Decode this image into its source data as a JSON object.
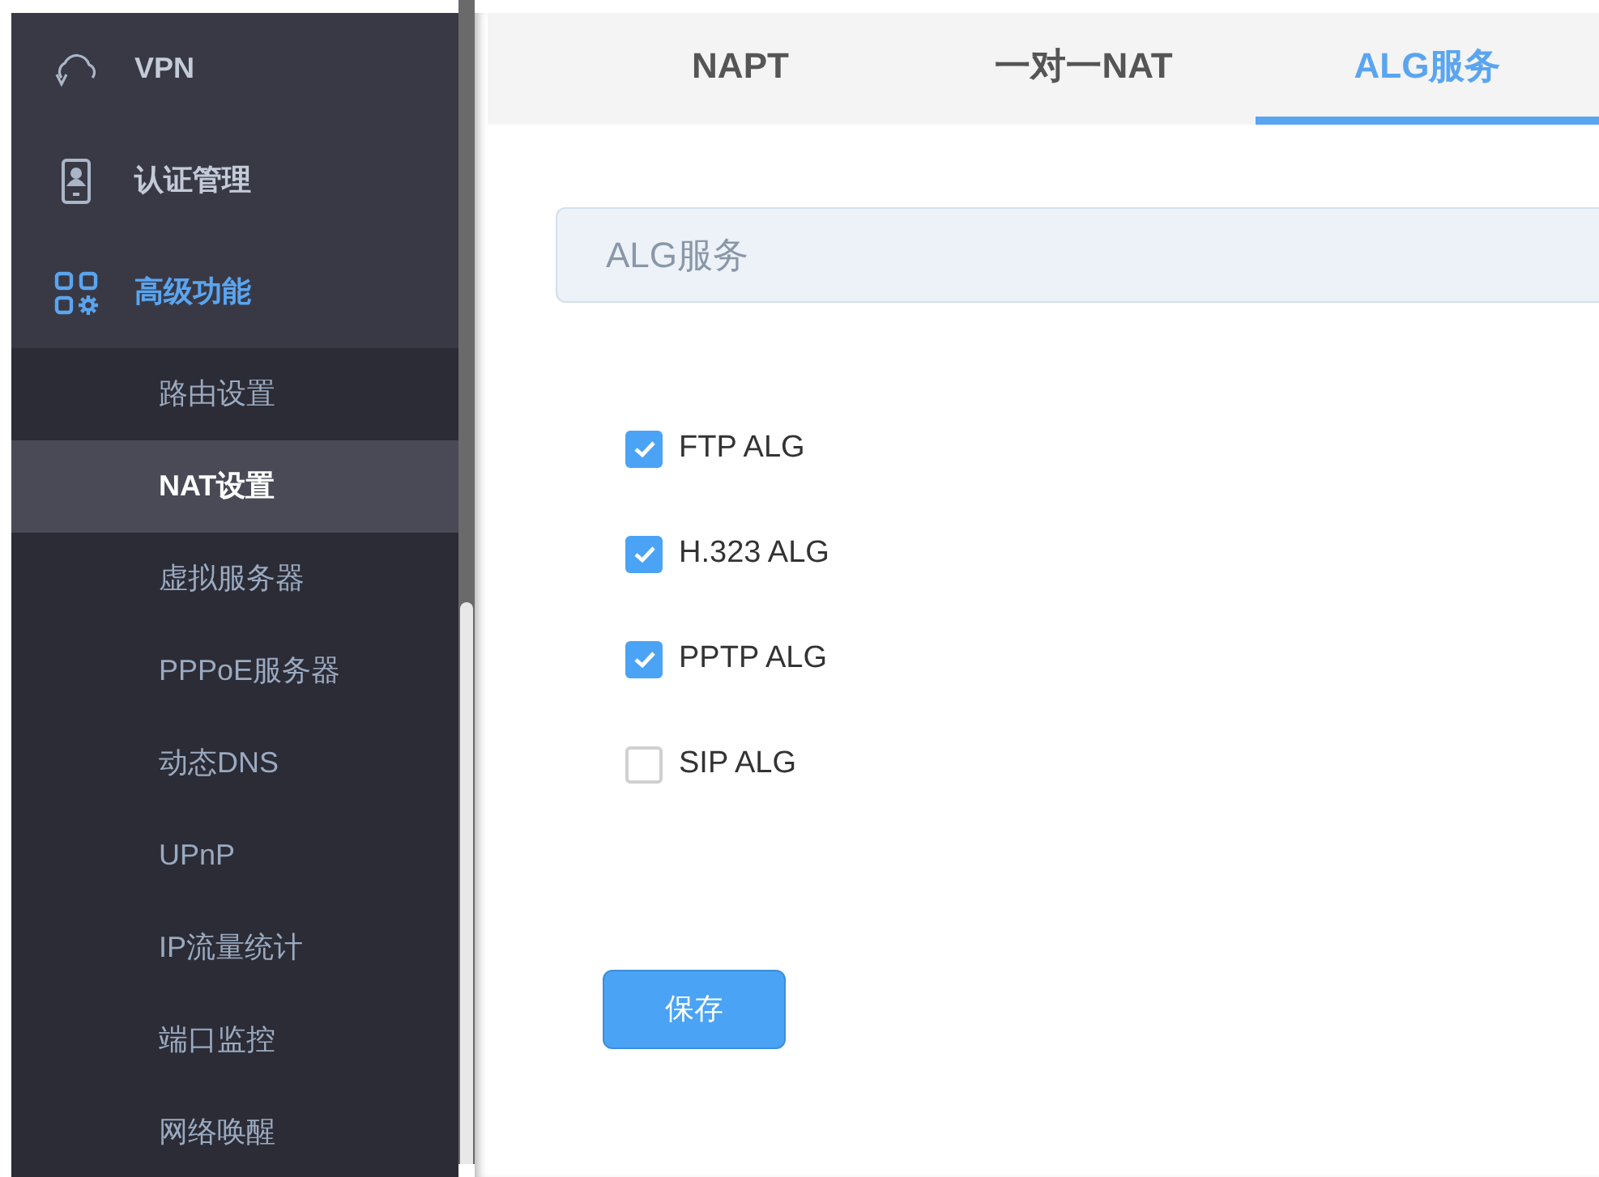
{
  "sidebar": {
    "items": [
      {
        "label": "VPN",
        "kind": "vpn",
        "selected": false
      },
      {
        "label": "认证管理",
        "kind": "auth",
        "selected": false
      },
      {
        "label": "高级功能",
        "kind": "advanced",
        "selected": true,
        "expanded": true,
        "children": [
          {
            "label": "路由设置",
            "selected": false
          },
          {
            "label": "NAT设置",
            "selected": true
          },
          {
            "label": "虚拟服务器",
            "selected": false
          },
          {
            "label": "PPPoE服务器",
            "selected": false
          },
          {
            "label": "动态DNS",
            "selected": false
          },
          {
            "label": "UPnP",
            "selected": false
          },
          {
            "label": "IP流量统计",
            "selected": false
          },
          {
            "label": "端口监控",
            "selected": false
          },
          {
            "label": "网络唤醒",
            "selected": false
          }
        ]
      }
    ]
  },
  "tabs": [
    {
      "label": "NAPT",
      "selected": false
    },
    {
      "label": "一对一NAT",
      "selected": false
    },
    {
      "label": "ALG服务",
      "selected": true
    }
  ],
  "section": {
    "title": "ALG服务"
  },
  "options": [
    {
      "label": "FTP ALG",
      "checked": true
    },
    {
      "label": "H.323 ALG",
      "checked": true
    },
    {
      "label": "PPTP ALG",
      "checked": true
    },
    {
      "label": "SIP ALG",
      "checked": false
    }
  ],
  "save_button": "保存"
}
